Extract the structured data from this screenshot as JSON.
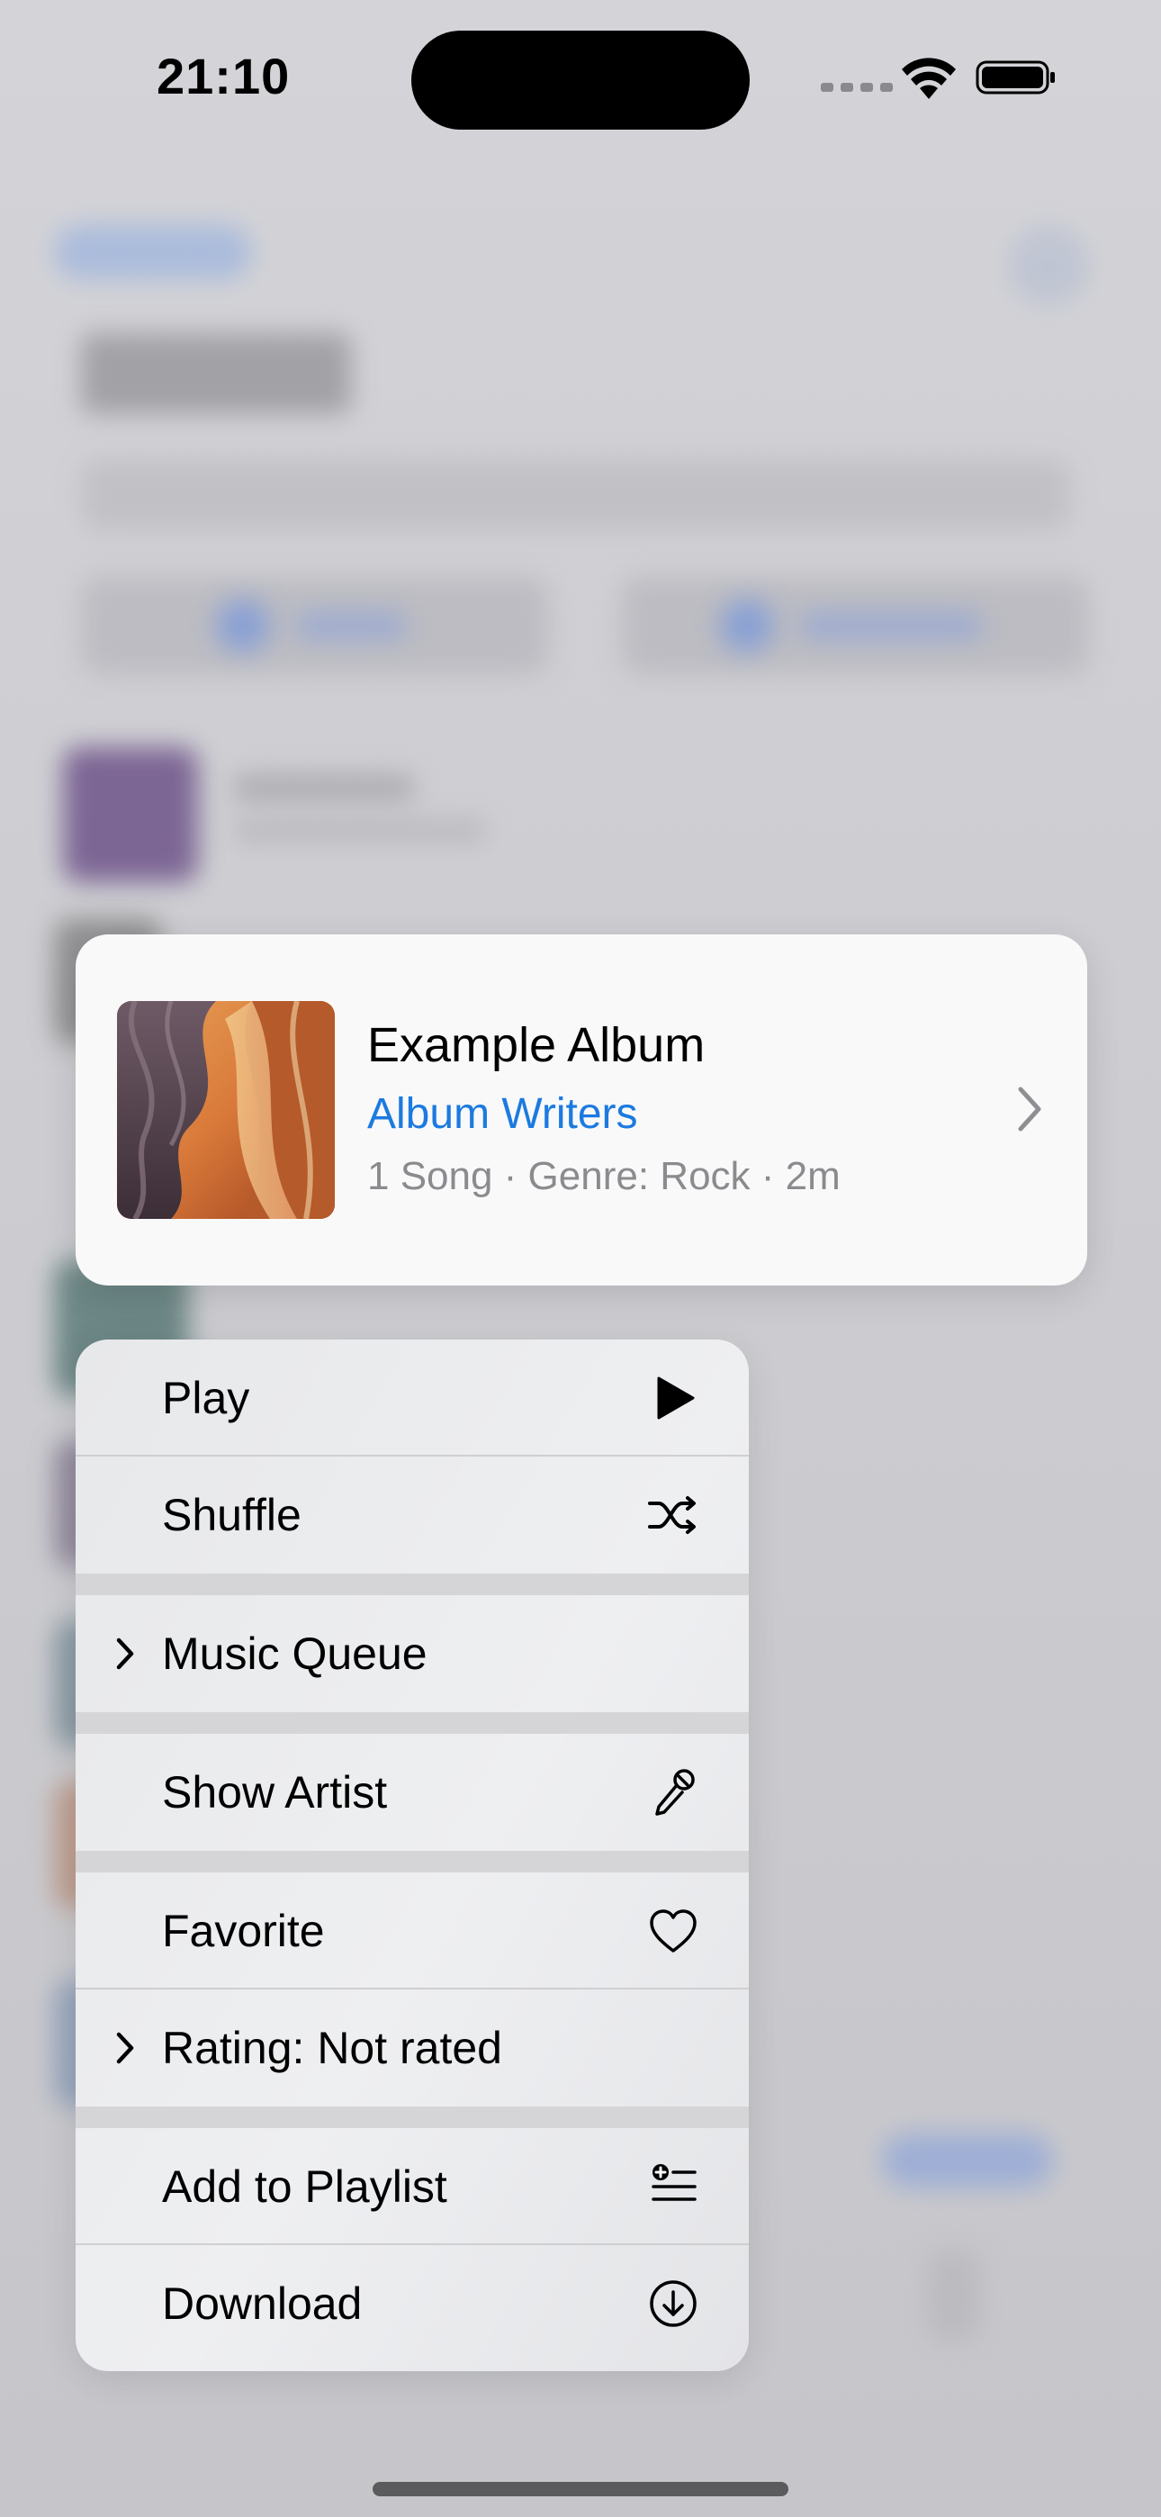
{
  "status_bar": {
    "time": "21:10"
  },
  "album_card": {
    "title": "Example Album",
    "artist": "Album Writers",
    "meta": "1 Song · Genre: Rock · 2m",
    "accent_color": "#1C7AE0",
    "cover_icon": "album-artwork"
  },
  "context_menu": {
    "items": [
      {
        "label": "Play",
        "icon": "play-icon"
      },
      {
        "label": "Shuffle",
        "icon": "shuffle-icon"
      },
      {
        "label": "Music Queue",
        "icon": "chevron-right-icon",
        "submenu": true
      },
      {
        "label": "Show Artist",
        "icon": "microphone-icon"
      },
      {
        "label": "Favorite",
        "icon": "heart-icon"
      },
      {
        "label": "Rating: Not rated",
        "icon": "chevron-right-icon",
        "submenu": true
      },
      {
        "label": "Add to Playlist",
        "icon": "add-to-playlist-icon"
      },
      {
        "label": "Download",
        "icon": "download-icon"
      }
    ]
  }
}
